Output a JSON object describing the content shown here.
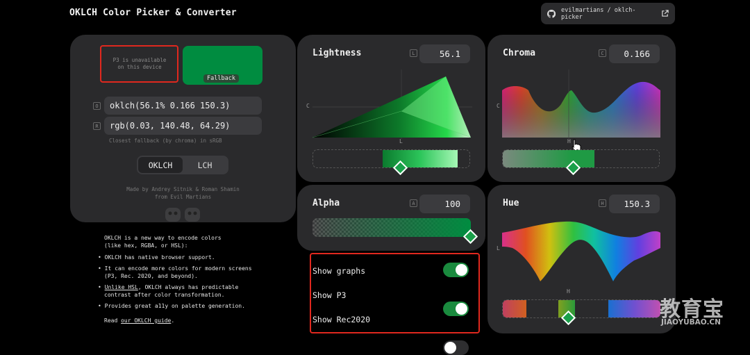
{
  "header": {
    "title": "OKLCH Color Picker & Converter",
    "repo_link": "evilmartians / oklch-picker"
  },
  "preview": {
    "p3_message_line1": "P3 is unavailable",
    "p3_message_line2": "on this device",
    "fallback_label": "Fallback",
    "fallback_color": "#008c40"
  },
  "fields": {
    "oklch_key": "O",
    "oklch_value": "oklch(56.1% 0.166 150.3)",
    "rgb_key": "R",
    "rgb_value": "rgb(0.03, 140.48, 64.29)",
    "fallback_note": "Closest fallback (by chroma) in sRGB"
  },
  "mode_switch": {
    "options": [
      "OKLCH",
      "LCH"
    ],
    "selected": "OKLCH"
  },
  "credits": {
    "line1": "Made by Andrey Sitnik & Roman Shamin",
    "line2": "from Evil Martians"
  },
  "info": {
    "intro_line1": "OKLCH is a new way to encode colors",
    "intro_line2": "(like hex, RGBA, or HSL):",
    "bullet1": "OKLCH has native browser support.",
    "bullet2_line1": "It can encode more colors for modern screens",
    "bullet2_line2": "(P3, Rec. 2020, and beyond).",
    "bullet3_link": "Unlike HSL",
    "bullet3_rest": ", OKLCH always has predictable",
    "bullet3_line2": "contrast after color transformation.",
    "bullet4": "Provides great a11y on palette generation.",
    "read_prefix": "Read ",
    "read_link": "our OKLCH guide",
    "read_suffix": "."
  },
  "panels": {
    "lightness": {
      "label": "Lightness",
      "key": "L",
      "value": "56.1",
      "axis_y": "C",
      "axis_x": "L"
    },
    "chroma": {
      "label": "Chroma",
      "key": "C",
      "value": "0.166",
      "axis_y": "C",
      "axis_x": "H"
    },
    "alpha": {
      "label": "Alpha",
      "key": "A",
      "value": "100"
    },
    "hue": {
      "label": "Hue",
      "key": "H",
      "value": "150.3",
      "axis_y": "L",
      "axis_x": "H"
    }
  },
  "settings": {
    "show_graphs": {
      "label": "Show graphs",
      "on": true
    },
    "show_p3": {
      "label": "Show P3",
      "on": true
    },
    "show_rec2020": {
      "label": "Show Rec2020",
      "on": false
    }
  },
  "watermark": {
    "chinese": "教育宝",
    "latin": "JIAOYUBAO.CN"
  },
  "colors": {
    "accent": "#1aa04a",
    "panel": "#2a2a2c",
    "highlight_border": "#e0281e"
  },
  "icons": [
    "github-icon",
    "external-link-icon",
    "cursor-hand-icon",
    "evil-martians-logo"
  ]
}
